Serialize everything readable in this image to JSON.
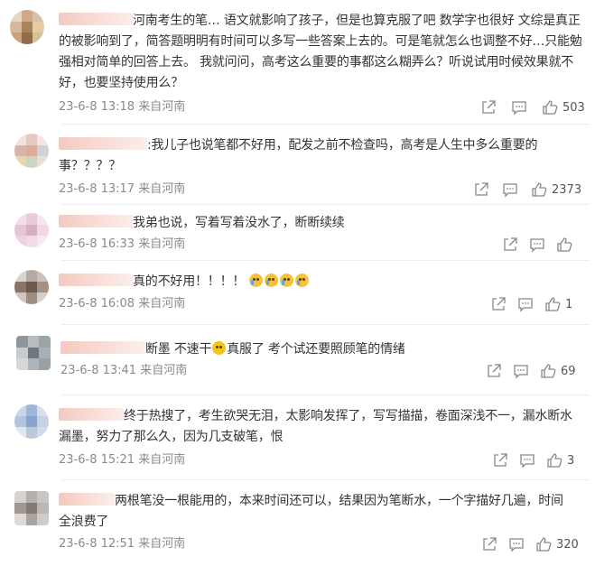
{
  "comments": [
    {
      "text": "河南考生的笔… 语文就影响了孩子，但是也算克服了吧 数学字也很好 文综是真正的被影响到了，简答题明明有时间可以多写一些答案上去的。可是笔就怎么也调整不好…只能勉强相对简单的回答上去。 我就问问，高考这么重要的事都这么糊弄么？听说试用时候效果就不好，也要坚持使用么？",
      "time": "23-6-8 13:18",
      "source": "来自河南",
      "likes": "503",
      "avatar_colors": [
        "#e7d7c2",
        "#cfa98a",
        "#d9c1a8",
        "#d6b89c",
        "#a8845e",
        "#e3cba5",
        "#c9a37a",
        "#8f6d4a",
        "#d8bf97"
      ]
    },
    {
      "text": ":我儿子也说笔都不好用，配发之前不检查吗，高考是人生中多么重要的事？？？？",
      "time": "23-6-8 13:17",
      "source": "来自河南",
      "likes": "2373",
      "avatar_colors": [
        "#f0e2de",
        "#e8c9c2",
        "#f3e6e2",
        "#d9b4a8",
        "#e0a99a",
        "#cfd3d8",
        "#e4d7b2",
        "#c9d7c0",
        "#e8e0d6"
      ]
    },
    {
      "text": "我弟也说，写着写着没水了，断断续续",
      "time": "23-6-8 16:33",
      "source": "来自河南",
      "likes": "",
      "avatar_colors": [
        "#f3dde6",
        "#eacbd8",
        "#f5e6ee",
        "#e6c6d4",
        "#d9aec3",
        "#f0d8e3",
        "#ecd3df",
        "#f1dce6",
        "#f6eaf0"
      ]
    },
    {
      "text": "真的不好用！！！！",
      "time": "23-6-8 16:08",
      "source": "来自河南",
      "likes": "1",
      "avatar_colors": [
        "#d9d4cf",
        "#b7aaa1",
        "#c9c1bb",
        "#8a7466",
        "#6d5a4e",
        "#a59184",
        "#cfc6bf",
        "#9d8c80",
        "#d7cfc9"
      ]
    },
    {
      "text_a": "断墨 不速干",
      "text_b": "真服了 考个试还要照顾笔的情绪",
      "time": "23-6-8 13:41",
      "source": "来自河南",
      "likes": "69",
      "avatar_colors": [
        "#8e969b",
        "#b6bcbf",
        "#9ca4a8",
        "#c8ccce",
        "#6e777c",
        "#a9b0b3",
        "#d5d8da",
        "#aeb4b7",
        "#9aa1a5"
      ]
    },
    {
      "text": "终于热搜了，考生欲哭无泪，太影响发挥了，写写描描，卷面深浅不一，漏水断水漏墨，努力了那么久，因为几支破笔，恨",
      "time": "23-6-8 15:21",
      "source": "来自河南",
      "likes": "3",
      "avatar_colors": [
        "#c9d6e8",
        "#9fb6d8",
        "#d7e0ec",
        "#b3c4dc",
        "#8aa3c8",
        "#c6d2e4",
        "#e0e6ee",
        "#bcc9da",
        "#d2dbe7"
      ]
    },
    {
      "text": "两根笔没一根能用的，本来时间还可以，结果因为笔断水，一个字描好几遍，时间全浪费了",
      "time": "23-6-8 12:51",
      "source": "来自河南",
      "likes": "320",
      "avatar_colors": [
        "#d6d3d1",
        "#b5b0ad",
        "#c9c5c2",
        "#9f9893",
        "#837a74",
        "#bdb7b3",
        "#dcd9d7",
        "#aaa4a0",
        "#cfcbc8"
      ]
    }
  ],
  "icons": {
    "share": "share-icon",
    "comment": "comment-icon",
    "like": "like-icon",
    "emoji_smile": "thinking-emoji-icon",
    "emoji_cry": "crying-emoji-icon"
  }
}
